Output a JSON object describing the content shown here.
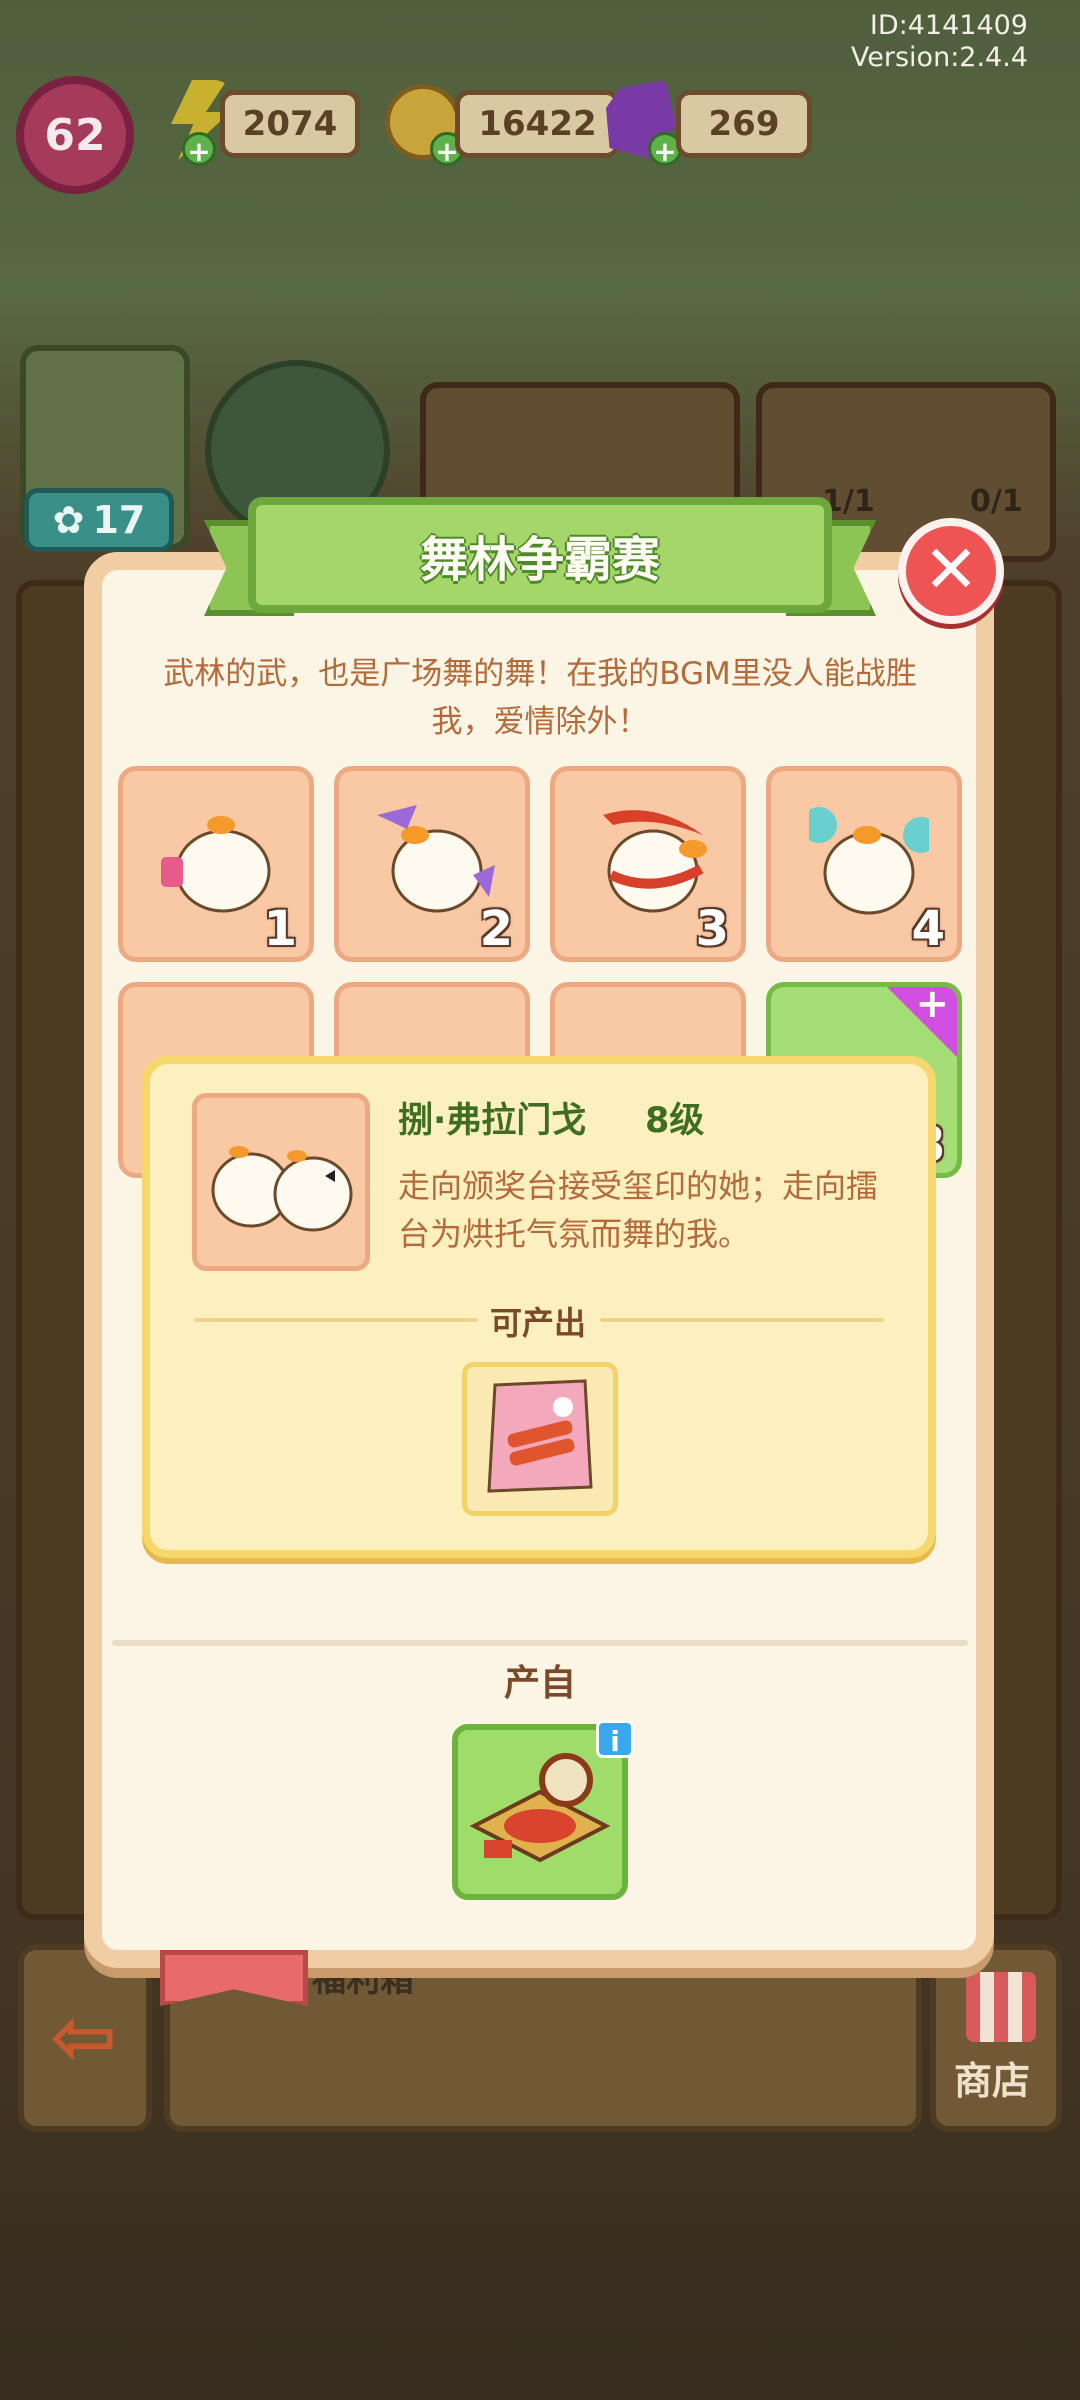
{
  "hud": {
    "id_text": "ID:4141409",
    "version_text": "Version:2.4.4",
    "level": "62",
    "energy": "2074",
    "coins": "16422",
    "gems": "269"
  },
  "background": {
    "friend_count": "17",
    "task_progress_1": "1/1",
    "task_progress_2": "0/1",
    "bottom_text": "福利箱",
    "shop_label": "商店"
  },
  "modal": {
    "title": "舞林争霸赛",
    "description": "武林的武，也是广场舞的舞！在我的BGM里没人能战胜我，爱情除外！",
    "items": [
      {
        "num": "1"
      },
      {
        "num": "2"
      },
      {
        "num": "3"
      },
      {
        "num": "4"
      },
      {
        "num": ""
      },
      {
        "num": ""
      },
      {
        "num": ""
      },
      {
        "num": "8"
      }
    ],
    "detail": {
      "name": "捌·弗拉门戈",
      "level": "8级",
      "text": "走向颁奖台接受玺印的她；走向擂台为烘托气氛而舞的我。",
      "produces_label": "可产出"
    },
    "source_label": "产自"
  },
  "colors": {
    "title_green": "#a5d66a",
    "close_red": "#ee5454",
    "slot_peach": "#f8c9a4",
    "slot_green": "#a5dd76",
    "text_brown": "#b56a3a"
  }
}
